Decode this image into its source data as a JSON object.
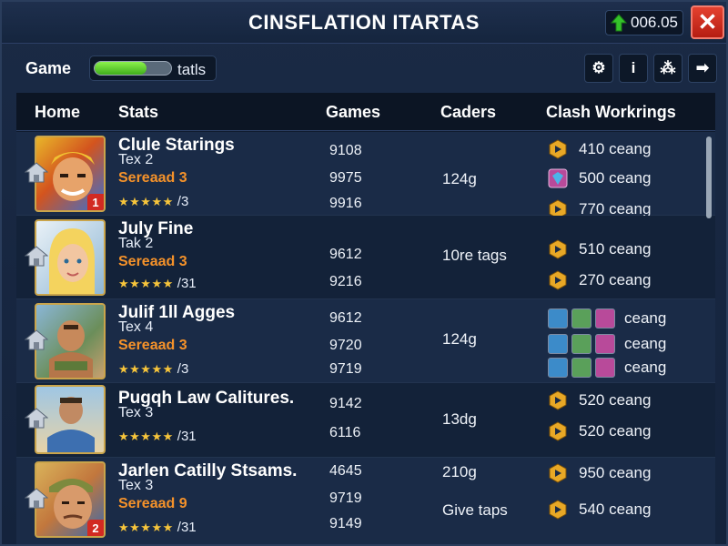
{
  "window": {
    "title": "CINSFLATION ITARTAS",
    "coins": "006.05",
    "close_label": "✕"
  },
  "toolbar": {
    "game_label": "Game",
    "progress_value": 0.68,
    "progress_text": "tatls",
    "buttons": [
      {
        "icon": "gear-icon",
        "glyph": "⚙"
      },
      {
        "icon": "info-icon",
        "glyph": "i"
      },
      {
        "icon": "network-icon",
        "glyph": "⁂"
      },
      {
        "icon": "arrow-right-icon",
        "glyph": "➡"
      }
    ]
  },
  "table": {
    "headers": [
      "Home",
      "Stats",
      "Games",
      "Caders",
      "Clash Workrings"
    ],
    "rows": [
      {
        "name": "Clule Starings",
        "sub": "Tex 2",
        "tier": "Sereaad 3",
        "stars": "★★★★★",
        "star_count": "/3",
        "rank": "1",
        "games": [
          "9108",
          "9975",
          "9916"
        ],
        "caders": [
          "124g"
        ],
        "clash": [
          {
            "icon": "hexagon-arrow-icon",
            "text": "410 ceang"
          },
          {
            "icon": "gem-icon",
            "text": "500 ceang"
          },
          {
            "icon": "hexagon-arrow-icon",
            "text": "770 ceang"
          }
        ]
      },
      {
        "name": "July Fine",
        "sub": "Tak 2",
        "tier": "Sereaad 3",
        "stars": "★★★★★",
        "star_count": "/31",
        "rank": "",
        "games": [
          "9612",
          "9216"
        ],
        "caders": [
          "10re tags"
        ],
        "clash": [
          {
            "icon": "hexagon-arrow-icon",
            "text": "510 ceang"
          },
          {
            "icon": "hexagon-arrow-icon",
            "text": "270 ceang"
          }
        ]
      },
      {
        "name": "Julif 1ll Agges",
        "sub": "Tex 4",
        "tier": "Sereaad 3",
        "stars": "★★★★★",
        "star_count": "/3",
        "rank": "",
        "games": [
          "9612",
          "9720",
          "9719"
        ],
        "caders": [
          "124g"
        ],
        "clash": [
          {
            "icon": "gem-set-icon",
            "text": "ceang"
          },
          {
            "icon": "gem-set-icon",
            "text": "ceang"
          },
          {
            "icon": "gem-set-icon",
            "text": "ceang"
          }
        ]
      },
      {
        "name": "Pugqh Law Calitures.",
        "sub": "Tex 3",
        "tier": "",
        "stars": "★★★★★",
        "star_count": "/31",
        "rank": "",
        "games": [
          "9142",
          "6116"
        ],
        "caders": [
          "13dg"
        ],
        "clash": [
          {
            "icon": "hexagon-arrow-icon",
            "text": "520 ceang"
          },
          {
            "icon": "hexagon-arrow-icon",
            "text": "520 ceang"
          }
        ]
      },
      {
        "name": "Jarlen Catilly Stsams.",
        "sub": "Tex 3",
        "tier": "Sereaad 9",
        "stars": "★★★★★",
        "star_count": "/31",
        "rank": "2",
        "games": [
          "4645",
          "9719",
          "9149"
        ],
        "caders": [
          "210g",
          "Give taps"
        ],
        "clash": [
          {
            "icon": "hexagon-arrow-icon",
            "text": "950 ceang"
          },
          {
            "icon": "hexagon-arrow-icon",
            "text": "540 ceang"
          }
        ]
      }
    ]
  },
  "colors": {
    "accent_orange": "#f5922a",
    "stars": "#f7c53b",
    "close_red": "#c9281b",
    "progress_green": "#5fd12b"
  }
}
